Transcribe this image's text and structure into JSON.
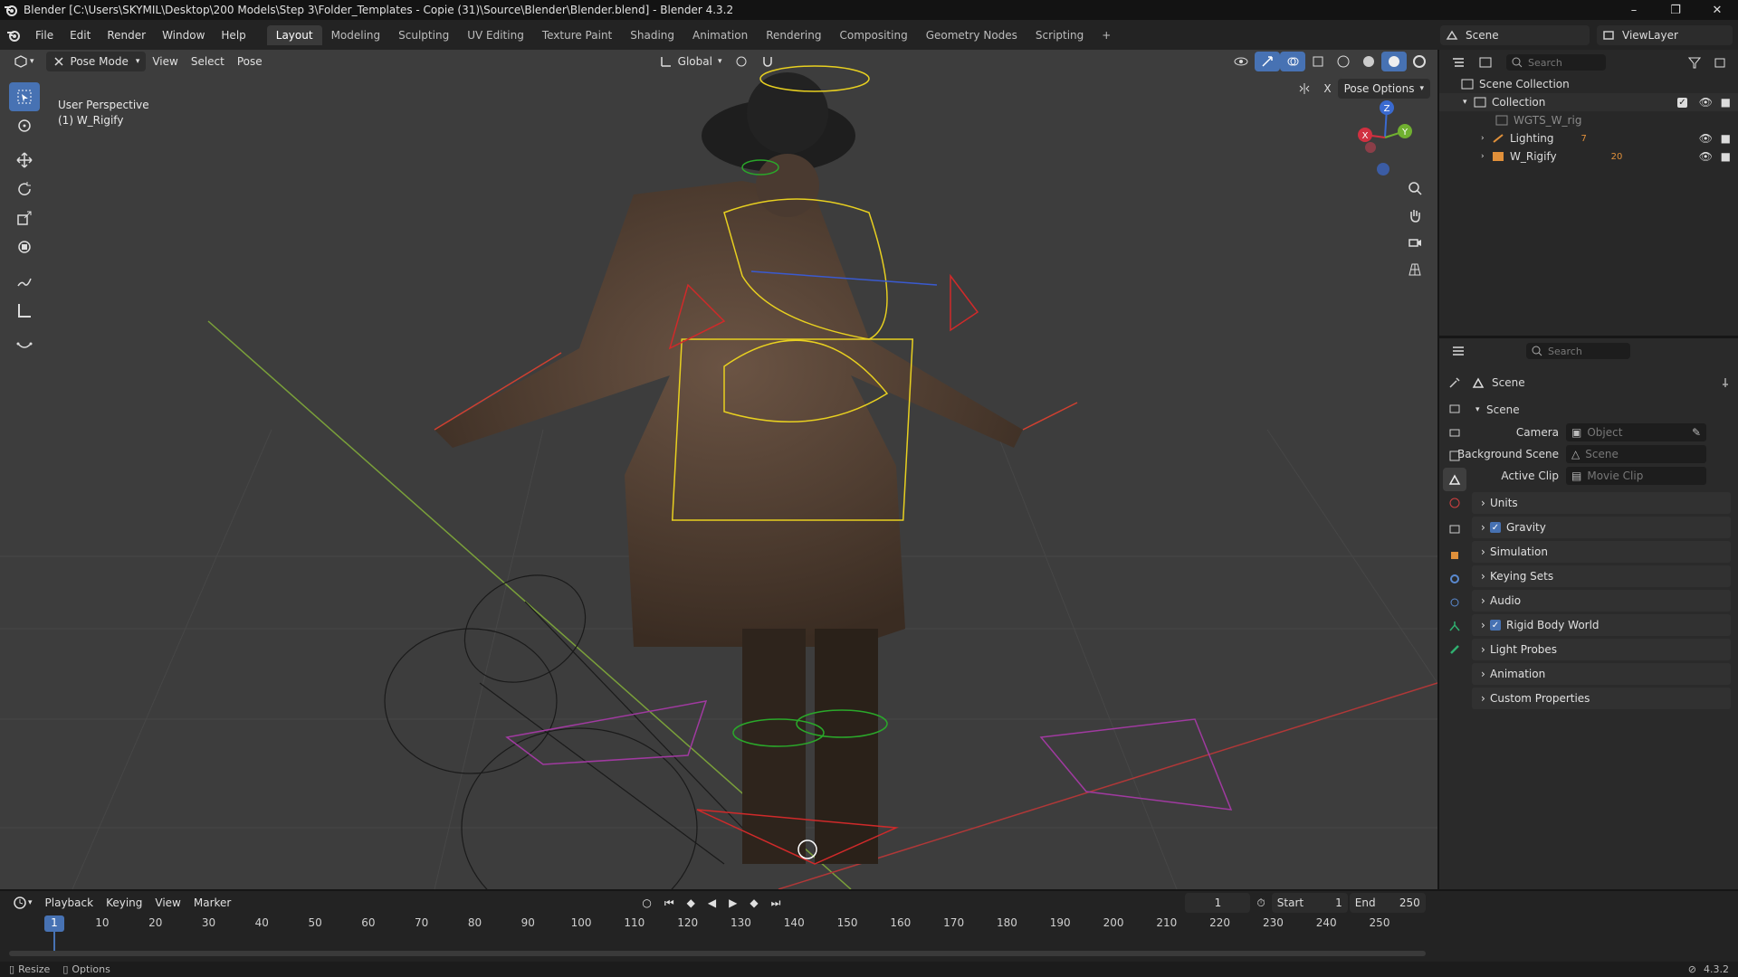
{
  "window": {
    "title": "Blender [C:\\Users\\SKYMIL\\Desktop\\200 Models\\Step 3\\Folder_Templates - Copie (31)\\Source\\Blender\\Blender.blend] - Blender 4.3.2",
    "minimize": "–",
    "maximize": "❐",
    "close": "✕"
  },
  "menu": [
    "File",
    "Edit",
    "Render",
    "Window",
    "Help"
  ],
  "workspaces": [
    "Layout",
    "Modeling",
    "Sculpting",
    "UV Editing",
    "Texture Paint",
    "Shading",
    "Animation",
    "Rendering",
    "Compositing",
    "Geometry Nodes",
    "Scripting"
  ],
  "workspace_add": "+",
  "scene_field": "Scene",
  "viewlayer_field": "ViewLayer",
  "viewport": {
    "mode": "Pose Mode",
    "menus": [
      "View",
      "Select",
      "Pose"
    ],
    "orientation": "Global",
    "overlay_title": "User Perspective",
    "overlay_object": "(1) W_Rigify",
    "pose_options": "Pose Options",
    "gizmo": {
      "z": "Z",
      "y": "Y",
      "x": "X"
    }
  },
  "outliner": {
    "search_placeholder": "Search",
    "rows": [
      {
        "label": "Scene Collection"
      },
      {
        "label": "Collection"
      },
      {
        "label": "WGTS_W_rig"
      },
      {
        "label": "Lighting",
        "badge": "7"
      },
      {
        "label": "W_Rigify",
        "badge": "20"
      }
    ]
  },
  "properties": {
    "search_placeholder": "Search",
    "context": "Scene",
    "section": "Scene",
    "fields": [
      {
        "label": "Camera",
        "placeholder": "Object"
      },
      {
        "label": "Background Scene",
        "placeholder": "Scene"
      },
      {
        "label": "Active Clip",
        "placeholder": "Movie Clip"
      }
    ],
    "panels": [
      {
        "label": "Units",
        "check": false
      },
      {
        "label": "Gravity",
        "check": true
      },
      {
        "label": "Simulation",
        "check": false
      },
      {
        "label": "Keying Sets",
        "check": false
      },
      {
        "label": "Audio",
        "check": false
      },
      {
        "label": "Rigid Body World",
        "check": true
      },
      {
        "label": "Light Probes",
        "check": false
      },
      {
        "label": "Animation",
        "check": false
      },
      {
        "label": "Custom Properties",
        "check": false
      }
    ]
  },
  "timeline": {
    "menus": [
      "Playback",
      "Keying",
      "View",
      "Marker"
    ],
    "current_frame": "1",
    "start_label": "Start",
    "start": "1",
    "end_label": "End",
    "end": "250",
    "ticks": [
      "1",
      "10",
      "20",
      "30",
      "40",
      "50",
      "60",
      "70",
      "80",
      "90",
      "100",
      "110",
      "120",
      "130",
      "140",
      "150",
      "160",
      "170",
      "180",
      "190",
      "200",
      "210",
      "220",
      "230",
      "240",
      "250"
    ]
  },
  "status": {
    "left1": "Resize",
    "left2": "Options",
    "version": "4.3.2"
  },
  "colors": {
    "accent": "#4772b3",
    "bone_yellow": "#e8d020",
    "bone_red": "#d02a2a",
    "bone_green": "#2aa82a",
    "widget_magenta": "#b040b0"
  }
}
